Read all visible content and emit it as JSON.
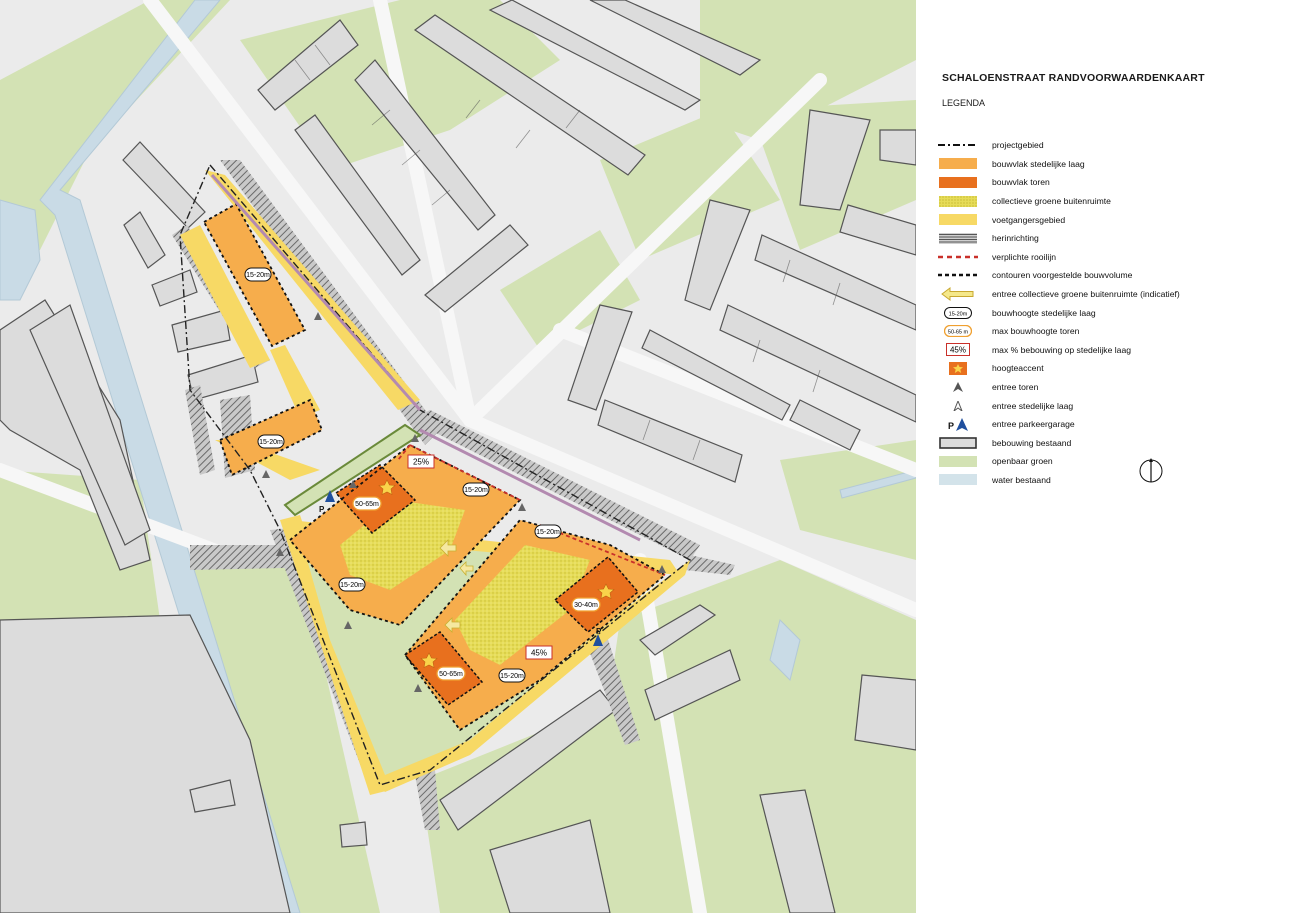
{
  "legend": {
    "title": "SCHALOENSTRAAT RANDVOORWAARDENKAART",
    "subtitle": "LEGENDA",
    "items": [
      {
        "key": "projectgebied",
        "label": "projectgebied",
        "icon": "dash-dot-line-icon"
      },
      {
        "key": "bouwvlak_stedelijk",
        "label": "bouwvlak stedelijke laag",
        "color": "#f6ad4c"
      },
      {
        "key": "bouwvlak_toren",
        "label": "bouwvlak toren",
        "color": "#e8701e"
      },
      {
        "key": "collectief_groen",
        "label": "collectieve groene buitenruimte",
        "color": "#e3d84f"
      },
      {
        "key": "voetgangers",
        "label": "voetgangersgebied",
        "color": "#f7d965"
      },
      {
        "key": "herinrichting",
        "label": "herinrichting",
        "icon": "hatched-stripes-icon"
      },
      {
        "key": "rooilijn",
        "label": "verplichte rooilijn",
        "color": "#c9302a"
      },
      {
        "key": "contouren",
        "label": "contouren voorgestelde bouwvolume",
        "icon": "dotted-line-icon"
      },
      {
        "key": "entree_groen",
        "label": "entree collectieve groene buitenruimte (indicatief)",
        "icon": "arrow-left-icon"
      },
      {
        "key": "bouwhoogte_stedelijk",
        "label": "bouwhoogte stedelijke laag",
        "badge": "15-20m"
      },
      {
        "key": "max_bouwhoogte_toren",
        "label": "max bouwhoogte toren",
        "badge": "50-65 m"
      },
      {
        "key": "max_bebouwing",
        "label": "max % bebouwing op stedelijke laag",
        "badge": "45%"
      },
      {
        "key": "hoogteaccent",
        "label": "hoogteaccent",
        "icon": "star-icon"
      },
      {
        "key": "entree_toren",
        "label": "entree toren",
        "icon": "triangle-dark-icon"
      },
      {
        "key": "entree_stedelijk",
        "label": "entree stedelijke laag",
        "icon": "triangle-light-icon"
      },
      {
        "key": "entree_parkeer",
        "label": "entree parkeergarage",
        "icon": "parking-triangle-icon",
        "prefix": "P"
      },
      {
        "key": "bebouwing",
        "label": "bebouwing bestaand",
        "color": "#dcdcdc"
      },
      {
        "key": "openbaar_groen",
        "label": "openbaar groen",
        "color": "#d3e2b4"
      },
      {
        "key": "water",
        "label": "water bestaand",
        "color": "#d3e3ea"
      }
    ]
  },
  "map_labels": {
    "h1": "15-20m",
    "h2": "15-20m",
    "h3": "15-20m",
    "h4": "15-20m",
    "h5": "15-20m",
    "h6": "15-20m",
    "t1": "50-65m",
    "t2": "30-40m",
    "t3": "50-65m",
    "p1": "25%",
    "p2": "45%",
    "parking": "P"
  },
  "colors": {
    "green": "#d3e2b4",
    "water": "#c9dbe6",
    "building": "#dcdcdc",
    "orange": "#f6ad4c",
    "tower": "#e8701e",
    "yellow": "#f7d965",
    "collective": "#e3d84f"
  }
}
